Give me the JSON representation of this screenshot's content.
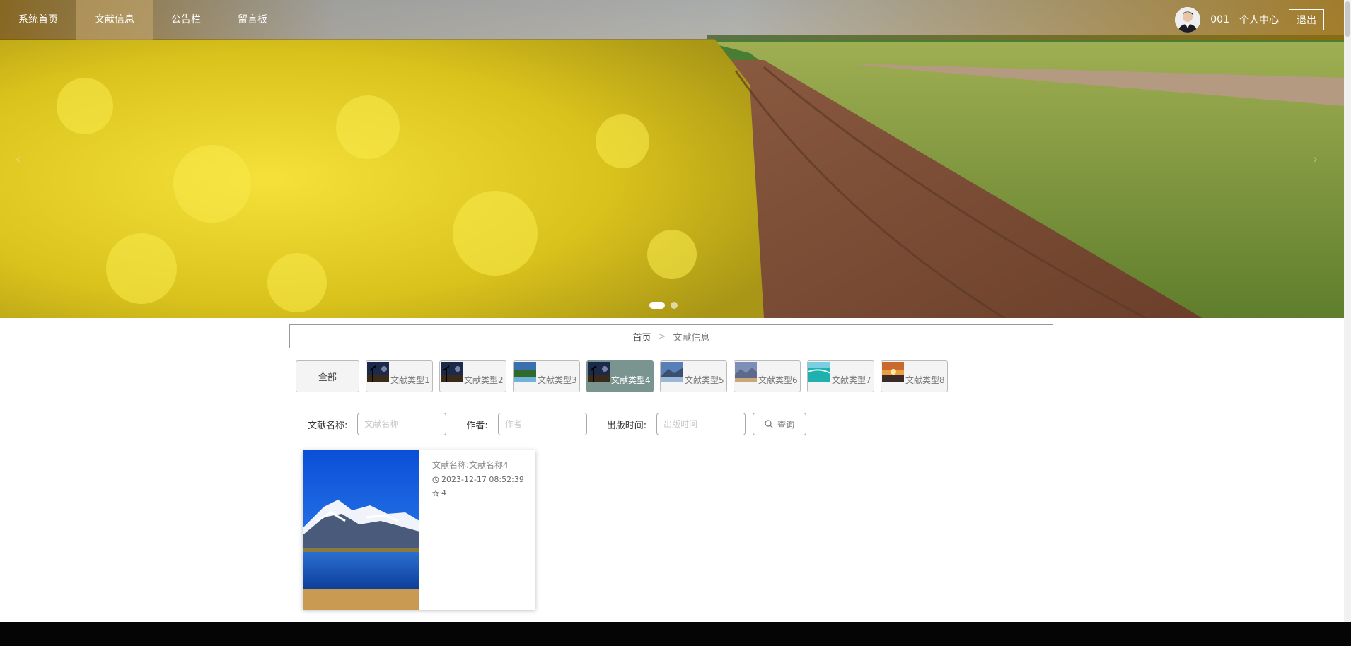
{
  "nav": {
    "items": [
      {
        "label": "系统首页",
        "active": false
      },
      {
        "label": "文献信息",
        "active": true
      },
      {
        "label": "公告栏",
        "active": false
      },
      {
        "label": "留言板",
        "active": false
      }
    ],
    "username": "001",
    "profile_label": "个人中心",
    "logout_label": "退出"
  },
  "breadcrumb": {
    "home": "首页",
    "separator": ">",
    "current": "文献信息"
  },
  "categories": {
    "all_label": "全部",
    "items": [
      {
        "label": "文献类型1",
        "active": false
      },
      {
        "label": "文献类型2",
        "active": false
      },
      {
        "label": "文献类型3",
        "active": false
      },
      {
        "label": "文献类型4",
        "active": true
      },
      {
        "label": "文献类型5",
        "active": false
      },
      {
        "label": "文献类型6",
        "active": false
      },
      {
        "label": "文献类型7",
        "active": false
      },
      {
        "label": "文献类型8",
        "active": false
      }
    ]
  },
  "search": {
    "name_label": "文献名称:",
    "name_placeholder": "文献名称",
    "author_label": "作者:",
    "author_placeholder": "作者",
    "date_label": "出版时间:",
    "date_placeholder": "出版时间",
    "button_label": "查询"
  },
  "results": [
    {
      "title": "文献名称:文献名称4",
      "time": "2023-12-17 08:52:39",
      "favorites": "4"
    }
  ],
  "carousel": {
    "slide_count": 2,
    "active_index": 0
  },
  "colors": {
    "active_chip": "#7a9590",
    "nav_active": "#c8aa6e",
    "footer": "#050505"
  }
}
